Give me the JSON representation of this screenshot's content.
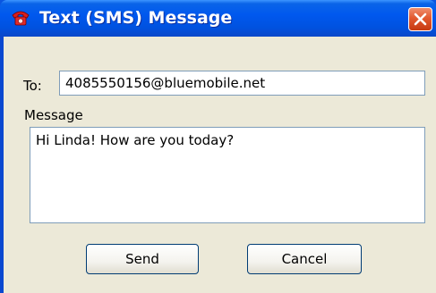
{
  "window": {
    "title": "Text (SMS) Message",
    "icon": "telephone-icon",
    "close": "close-icon"
  },
  "form": {
    "to_label": "To:",
    "to_value": "4085550156@bluemobile.net",
    "message_label": "Message",
    "message_value": "Hi Linda! How are you today?"
  },
  "buttons": {
    "send": "Send",
    "cancel": "Cancel"
  },
  "colors": {
    "titlebar": "#0058ee",
    "client": "#ece9d8",
    "close_button": "#e2592f",
    "input_border": "#7f9db9"
  }
}
